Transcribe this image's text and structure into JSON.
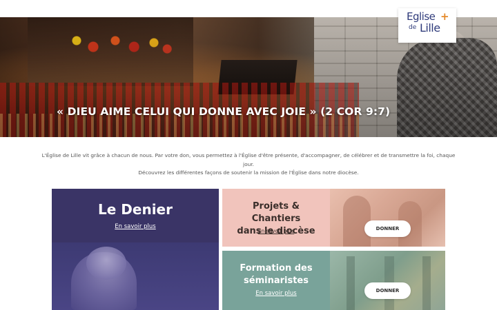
{
  "logo": {
    "line1": "Eglise",
    "line2": "de",
    "line3": "Lille",
    "cross": "+"
  },
  "hero": {
    "title": "« DIEU AIME CELUI QUI DONNE AVEC JOIE » (2 COR 9:7)"
  },
  "intro": {
    "line1": "L'Église de Lille vit grâce à chacun de nous. Par votre don, vous permettez à l'Église d'être présente, d'accompagner, de célébrer et de transmettre la foi, chaque jour.",
    "line2": "Découvrez les différentes façons de soutenir la mission de l'Église dans notre diocèse."
  },
  "cards": {
    "denier": {
      "title": "Le Denier",
      "link": "En savoir plus"
    },
    "projets": {
      "title_line1": "Projets & Chantiers",
      "title_line2": "dans le diocèse",
      "link": "En savoir plus",
      "button": "DONNER"
    },
    "formation": {
      "title_line1": "Formation des",
      "title_line2": "séminaristes",
      "link": "En savoir plus",
      "button": "DONNER"
    }
  },
  "colors": {
    "denier_bg": "#3a3466",
    "projets_bg": "#f1c4bc",
    "formation_bg": "#79a39a",
    "logo_blue": "#2e3a7a",
    "logo_accent": "#e58a2a"
  },
  "icons": [
    "cross-icon"
  ]
}
